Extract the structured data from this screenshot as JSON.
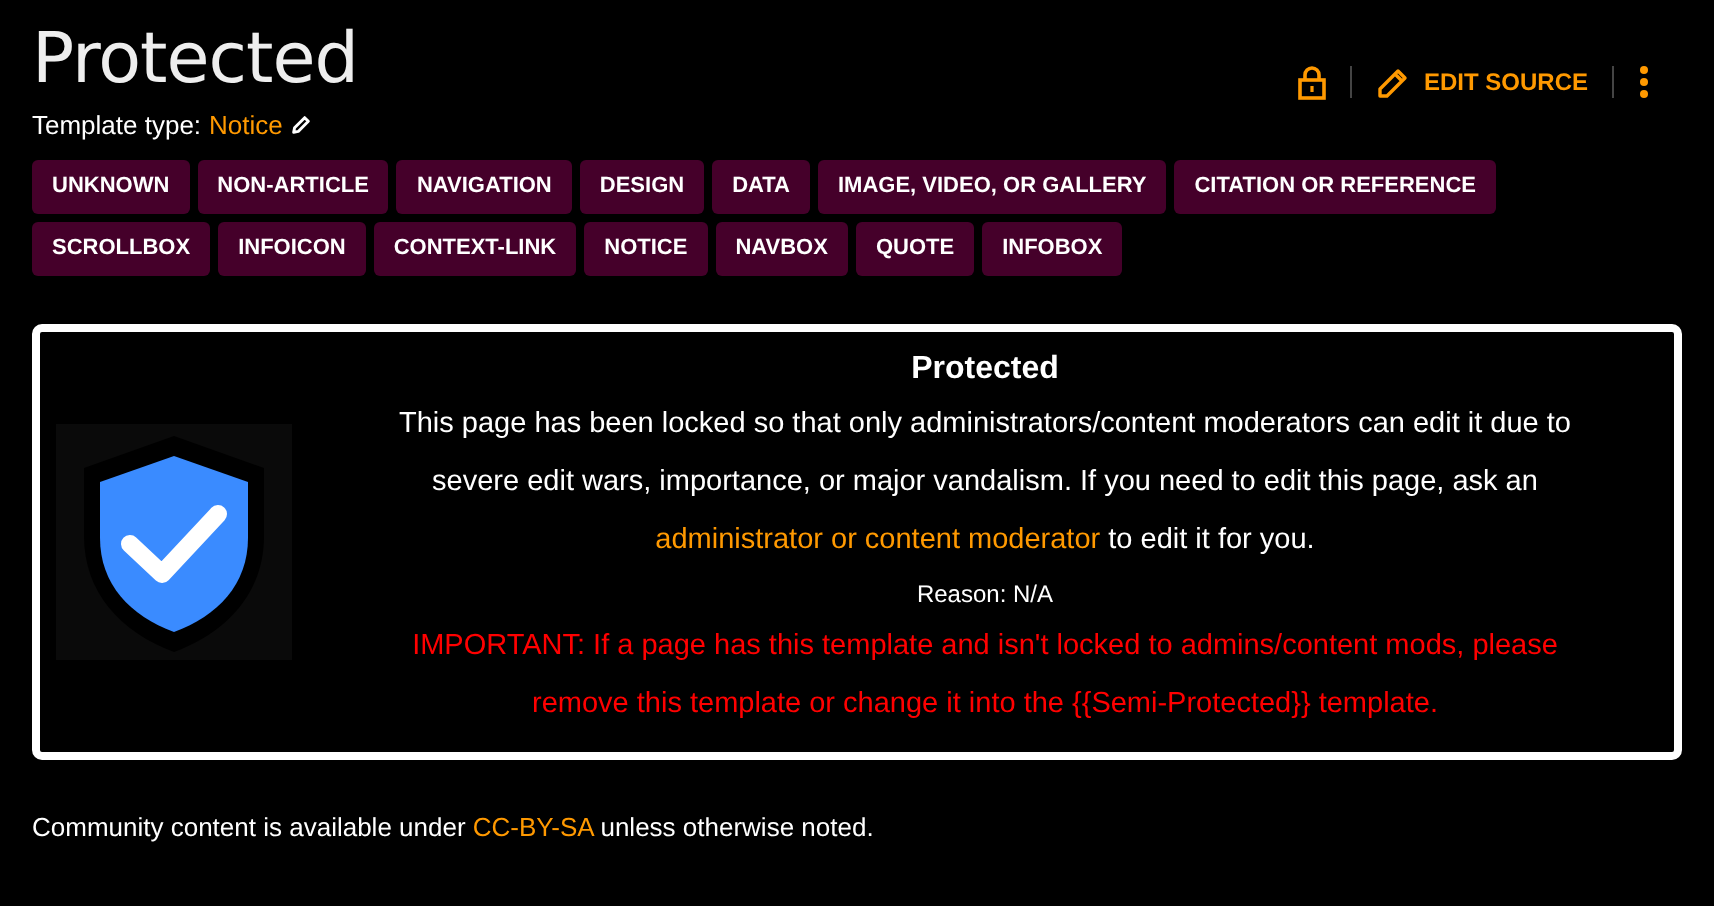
{
  "page": {
    "title": "Protected",
    "template_type_label": "Template type:",
    "template_type": "Notice"
  },
  "actions": {
    "edit_source": "EDIT SOURCE"
  },
  "categories": [
    {
      "label": "UNKNOWN"
    },
    {
      "label": "NON-ARTICLE"
    },
    {
      "label": "NAVIGATION"
    },
    {
      "label": "DESIGN"
    },
    {
      "label": "DATA"
    },
    {
      "label": "IMAGE, VIDEO, OR GALLERY"
    },
    {
      "label": "CITATION OR REFERENCE"
    },
    {
      "label": "SCROLLBOX"
    },
    {
      "label": "INFOICON"
    },
    {
      "label": "CONTEXT-LINK"
    },
    {
      "label": "NOTICE"
    },
    {
      "label": "NAVBOX"
    },
    {
      "label": "QUOTE"
    },
    {
      "label": "INFOBOX"
    }
  ],
  "notice": {
    "title": "Protected",
    "text_before": "This page has been locked so that only administrators/content moderators can edit it due to severe edit wars, importance, or major vandalism. If you need to edit this page, ask an",
    "link": "administrator or content moderator",
    "text_after": "to edit it for you.",
    "reason": "Reason: N/A",
    "important": "IMPORTANT: If a page has this template and isn't locked to admins/content mods, please remove this template or change it into the {{Semi-Protected}} template."
  },
  "footer": {
    "text_before": "Community content is available under",
    "link": "CC-BY-SA",
    "text_after": "unless otherwise noted."
  }
}
